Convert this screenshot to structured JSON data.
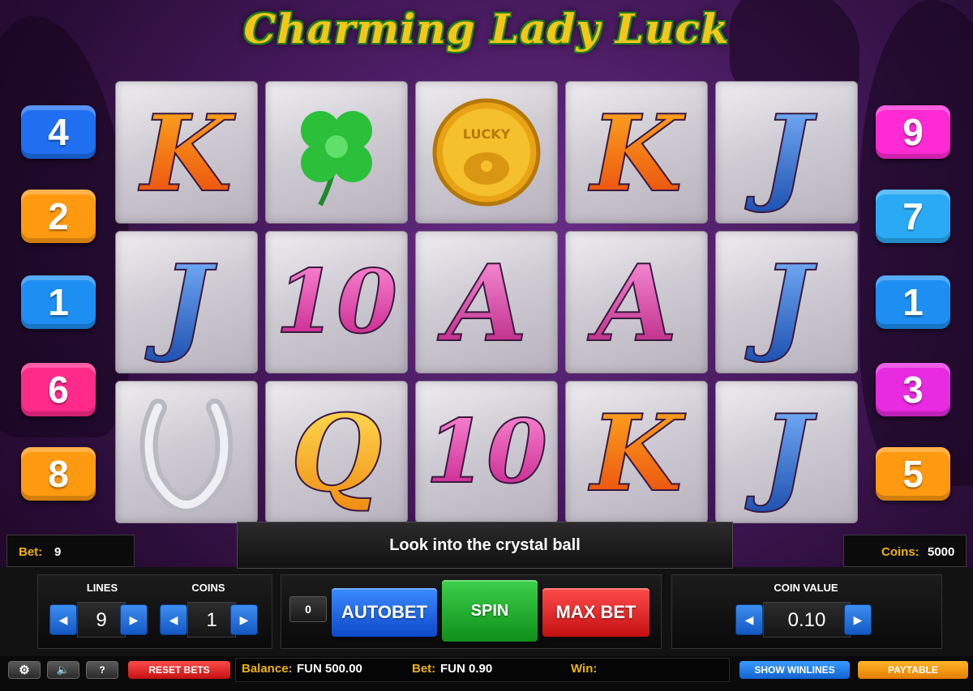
{
  "title": "Charming Lady Luck",
  "left_lines": [
    {
      "label": "4",
      "color": "#1f6ff0"
    },
    {
      "label": "2",
      "color": "#ff9a10"
    },
    {
      "label": "1",
      "color": "#1e8ff2"
    },
    {
      "label": "6",
      "color": "#ff2a8a"
    },
    {
      "label": "8",
      "color": "#ff9a10"
    }
  ],
  "right_lines": [
    {
      "label": "9",
      "color": "#ff2ad4"
    },
    {
      "label": "7",
      "color": "#2aaaf5"
    },
    {
      "label": "1",
      "color": "#1e8ff2"
    },
    {
      "label": "3",
      "color": "#e82ae0"
    },
    {
      "label": "5",
      "color": "#ff9a10"
    }
  ],
  "reels": [
    [
      "K",
      "clover",
      "coin",
      "K",
      "J"
    ],
    [
      "J",
      "10",
      "A",
      "A",
      "J"
    ],
    [
      "horseshoe",
      "Q",
      "10",
      "K",
      "J"
    ]
  ],
  "coin_text": "LUCKY",
  "bet_label": "Bet:",
  "bet_value": "9",
  "message": "Look into the crystal ball",
  "coins_label": "Coins:",
  "coins_value": "5000",
  "lines_label": "LINES",
  "lines_value": "9",
  "coins_stepper_label": "COINS",
  "coins_stepper_value": "1",
  "autobet_count": "0",
  "autobet_label": "AUTOBET",
  "spin_label": "SPIN",
  "maxbet_label": "MAX BET",
  "coin_value_label": "COIN VALUE",
  "coin_value": "0.10",
  "help_label": "?",
  "reset_bets_label": "RESET BETS",
  "balance_label": "Balance:",
  "balance_value": "FUN 500.00",
  "bottom_bet_label": "Bet:",
  "bottom_bet_value": "FUN 0.90",
  "win_label": "Win:",
  "win_value": "",
  "show_winlines_label": "SHOW WINLINES",
  "paytable_label": "PAYTABLE"
}
